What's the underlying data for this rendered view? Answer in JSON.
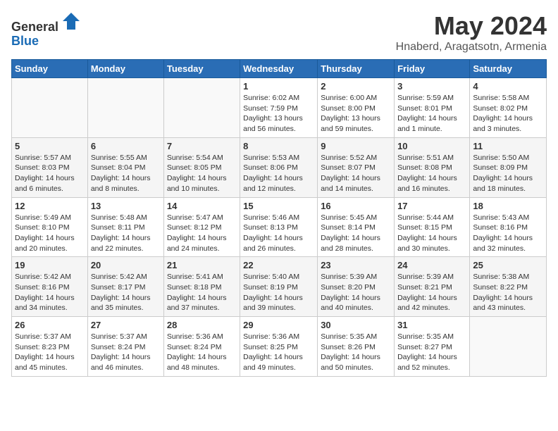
{
  "header": {
    "logo_general": "General",
    "logo_blue": "Blue",
    "month": "May 2024",
    "location": "Hnaberd, Aragatsotn, Armenia"
  },
  "weekdays": [
    "Sunday",
    "Monday",
    "Tuesday",
    "Wednesday",
    "Thursday",
    "Friday",
    "Saturday"
  ],
  "weeks": [
    [
      {
        "day": "",
        "info": ""
      },
      {
        "day": "",
        "info": ""
      },
      {
        "day": "",
        "info": ""
      },
      {
        "day": "1",
        "info": "Sunrise: 6:02 AM\nSunset: 7:59 PM\nDaylight: 13 hours\nand 56 minutes."
      },
      {
        "day": "2",
        "info": "Sunrise: 6:00 AM\nSunset: 8:00 PM\nDaylight: 13 hours\nand 59 minutes."
      },
      {
        "day": "3",
        "info": "Sunrise: 5:59 AM\nSunset: 8:01 PM\nDaylight: 14 hours\nand 1 minute."
      },
      {
        "day": "4",
        "info": "Sunrise: 5:58 AM\nSunset: 8:02 PM\nDaylight: 14 hours\nand 3 minutes."
      }
    ],
    [
      {
        "day": "5",
        "info": "Sunrise: 5:57 AM\nSunset: 8:03 PM\nDaylight: 14 hours\nand 6 minutes."
      },
      {
        "day": "6",
        "info": "Sunrise: 5:55 AM\nSunset: 8:04 PM\nDaylight: 14 hours\nand 8 minutes."
      },
      {
        "day": "7",
        "info": "Sunrise: 5:54 AM\nSunset: 8:05 PM\nDaylight: 14 hours\nand 10 minutes."
      },
      {
        "day": "8",
        "info": "Sunrise: 5:53 AM\nSunset: 8:06 PM\nDaylight: 14 hours\nand 12 minutes."
      },
      {
        "day": "9",
        "info": "Sunrise: 5:52 AM\nSunset: 8:07 PM\nDaylight: 14 hours\nand 14 minutes."
      },
      {
        "day": "10",
        "info": "Sunrise: 5:51 AM\nSunset: 8:08 PM\nDaylight: 14 hours\nand 16 minutes."
      },
      {
        "day": "11",
        "info": "Sunrise: 5:50 AM\nSunset: 8:09 PM\nDaylight: 14 hours\nand 18 minutes."
      }
    ],
    [
      {
        "day": "12",
        "info": "Sunrise: 5:49 AM\nSunset: 8:10 PM\nDaylight: 14 hours\nand 20 minutes."
      },
      {
        "day": "13",
        "info": "Sunrise: 5:48 AM\nSunset: 8:11 PM\nDaylight: 14 hours\nand 22 minutes."
      },
      {
        "day": "14",
        "info": "Sunrise: 5:47 AM\nSunset: 8:12 PM\nDaylight: 14 hours\nand 24 minutes."
      },
      {
        "day": "15",
        "info": "Sunrise: 5:46 AM\nSunset: 8:13 PM\nDaylight: 14 hours\nand 26 minutes."
      },
      {
        "day": "16",
        "info": "Sunrise: 5:45 AM\nSunset: 8:14 PM\nDaylight: 14 hours\nand 28 minutes."
      },
      {
        "day": "17",
        "info": "Sunrise: 5:44 AM\nSunset: 8:15 PM\nDaylight: 14 hours\nand 30 minutes."
      },
      {
        "day": "18",
        "info": "Sunrise: 5:43 AM\nSunset: 8:16 PM\nDaylight: 14 hours\nand 32 minutes."
      }
    ],
    [
      {
        "day": "19",
        "info": "Sunrise: 5:42 AM\nSunset: 8:16 PM\nDaylight: 14 hours\nand 34 minutes."
      },
      {
        "day": "20",
        "info": "Sunrise: 5:42 AM\nSunset: 8:17 PM\nDaylight: 14 hours\nand 35 minutes."
      },
      {
        "day": "21",
        "info": "Sunrise: 5:41 AM\nSunset: 8:18 PM\nDaylight: 14 hours\nand 37 minutes."
      },
      {
        "day": "22",
        "info": "Sunrise: 5:40 AM\nSunset: 8:19 PM\nDaylight: 14 hours\nand 39 minutes."
      },
      {
        "day": "23",
        "info": "Sunrise: 5:39 AM\nSunset: 8:20 PM\nDaylight: 14 hours\nand 40 minutes."
      },
      {
        "day": "24",
        "info": "Sunrise: 5:39 AM\nSunset: 8:21 PM\nDaylight: 14 hours\nand 42 minutes."
      },
      {
        "day": "25",
        "info": "Sunrise: 5:38 AM\nSunset: 8:22 PM\nDaylight: 14 hours\nand 43 minutes."
      }
    ],
    [
      {
        "day": "26",
        "info": "Sunrise: 5:37 AM\nSunset: 8:23 PM\nDaylight: 14 hours\nand 45 minutes."
      },
      {
        "day": "27",
        "info": "Sunrise: 5:37 AM\nSunset: 8:24 PM\nDaylight: 14 hours\nand 46 minutes."
      },
      {
        "day": "28",
        "info": "Sunrise: 5:36 AM\nSunset: 8:24 PM\nDaylight: 14 hours\nand 48 minutes."
      },
      {
        "day": "29",
        "info": "Sunrise: 5:36 AM\nSunset: 8:25 PM\nDaylight: 14 hours\nand 49 minutes."
      },
      {
        "day": "30",
        "info": "Sunrise: 5:35 AM\nSunset: 8:26 PM\nDaylight: 14 hours\nand 50 minutes."
      },
      {
        "day": "31",
        "info": "Sunrise: 5:35 AM\nSunset: 8:27 PM\nDaylight: 14 hours\nand 52 minutes."
      },
      {
        "day": "",
        "info": ""
      }
    ]
  ]
}
